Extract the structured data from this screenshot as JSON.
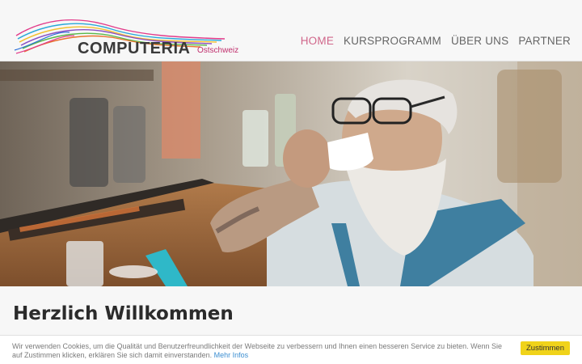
{
  "logo": {
    "name": "COMPUTERIA",
    "region": "Ostschweiz"
  },
  "nav": [
    {
      "label": "HOME",
      "active": true
    },
    {
      "label": "KURSPROGRAMM",
      "active": false
    },
    {
      "label": "ÜBER UNS",
      "active": false
    },
    {
      "label": "PARTNER",
      "active": false
    }
  ],
  "main": {
    "heading": "Herzlich Willkommen"
  },
  "cookie": {
    "text": "Wir verwenden Cookies, um die Qualität und Benutzerfreundlichkeit der Webseite zu verbessern und Ihnen einen besseren Service zu bieten. Wenn Sie auf Zustimmen klicken, erklären Sie sich damit einverstanden.",
    "link": "Mehr Infos",
    "button": "Zustimmen"
  },
  "colors": {
    "accent": "#d0668a",
    "button": "#f0d31a",
    "link": "#3b8ed1"
  }
}
